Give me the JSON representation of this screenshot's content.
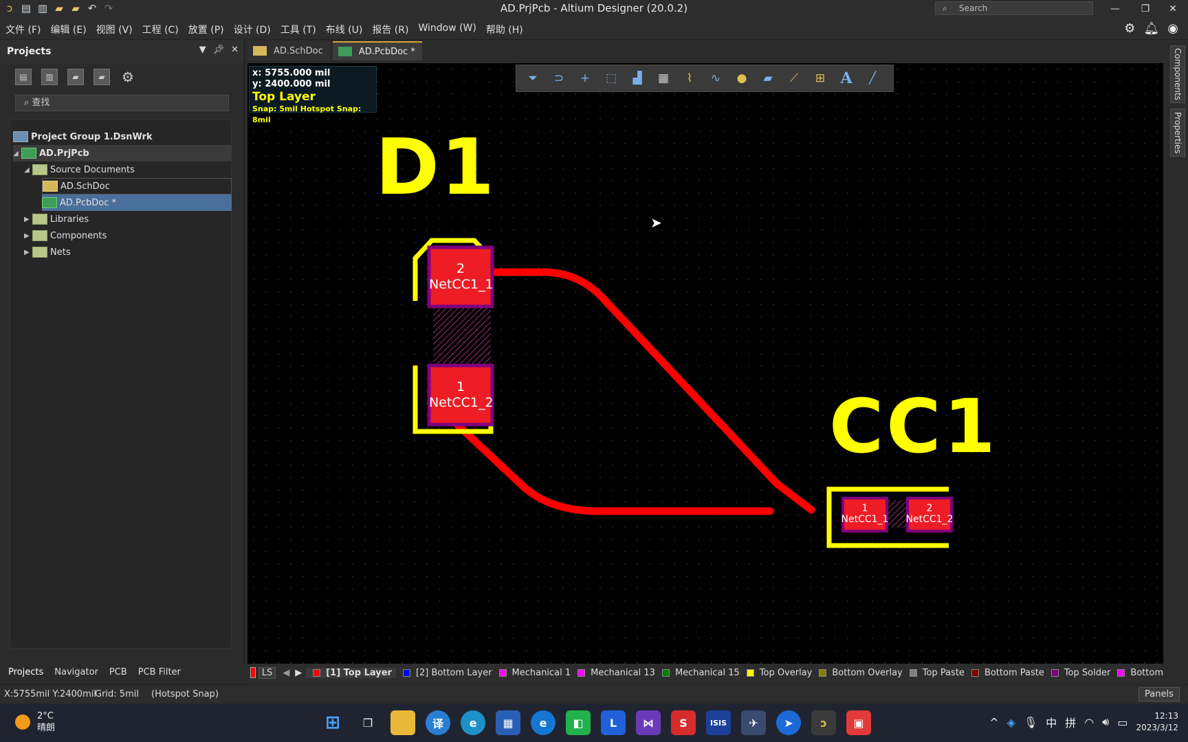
{
  "app": {
    "title": "AD.PrjPcb - Altium Designer (20.0.2)",
    "search_placeholder": "Search"
  },
  "menu": [
    "文件 (F)",
    "编辑 (E)",
    "视图 (V)",
    "工程 (C)",
    "放置 (P)",
    "设计 (D)",
    "工具 (T)",
    "布线 (U)",
    "报告 (R)",
    "Window (W)",
    "帮助 (H)"
  ],
  "projects_panel": {
    "title": "Projects",
    "search_placeholder": "查找",
    "tree": [
      {
        "label": "Project Group 1.DsnWrk",
        "level": 0
      },
      {
        "label": "AD.PrjPcb",
        "level": 1
      },
      {
        "label": "Source Documents",
        "level": 2
      },
      {
        "label": "AD.SchDoc",
        "level": 3
      },
      {
        "label": "AD.PcbDoc *",
        "level": 3
      },
      {
        "label": "Libraries",
        "level": 2
      },
      {
        "label": "Components",
        "level": 2
      },
      {
        "label": "Nets",
        "level": 2
      }
    ],
    "bottom_tabs": [
      "Projects",
      "Navigator",
      "PCB",
      "PCB Filter"
    ]
  },
  "doc_tabs": [
    {
      "label": "AD.SchDoc"
    },
    {
      "label": "AD.PcbDoc *"
    }
  ],
  "hud": {
    "x": "x:  5755.000 mil",
    "y": "y:  2400.000 mil",
    "layer": "Top Layer",
    "snap": "Snap: 5mil Hotspot Snap: 8mil"
  },
  "pcb": {
    "d1": {
      "designator": "D1",
      "pad2_num": "2",
      "pad2_net": "NetCC1_1",
      "pad1_num": "1",
      "pad1_net": "NetCC1_2"
    },
    "cc1": {
      "designator": "CC1",
      "pad1_num": "1",
      "pad1_net": "NetCC1_1",
      "pad2_num": "2",
      "pad2_net": "NetCC1_2"
    },
    "colors": {
      "track": "#ff0000",
      "overlay": "#ffff00",
      "pad": "#ee1c24",
      "solder": "#800080"
    }
  },
  "right_panels": [
    "Components",
    "Properties"
  ],
  "layers": [
    {
      "label": "LS",
      "color": ""
    },
    {
      "label": "[1] Top Layer",
      "color": "#ff0000"
    },
    {
      "label": "[2] Bottom Layer",
      "color": "#0000ff"
    },
    {
      "label": "Mechanical 1",
      "color": "#ff00ff"
    },
    {
      "label": "Mechanical 13",
      "color": "#ff00ff"
    },
    {
      "label": "Mechanical 15",
      "color": "#008000"
    },
    {
      "label": "Top Overlay",
      "color": "#ffff00"
    },
    {
      "label": "Bottom Overlay",
      "color": "#808000"
    },
    {
      "label": "Top Paste",
      "color": "#808080"
    },
    {
      "label": "Bottom Paste",
      "color": "#800000"
    },
    {
      "label": "Top Solder",
      "color": "#800080"
    },
    {
      "label": "Bottom",
      "color": "#ff00ff"
    }
  ],
  "status": {
    "coords": "X:5755mil Y:2400mil",
    "grid": "Grid: 5mil",
    "snap": "(Hotspot Snap)",
    "panels": "Panels"
  },
  "taskbar": {
    "temp": "2°C",
    "weather": "晴朗",
    "time": "12:13",
    "date": "2023/3/12",
    "ime1": "中",
    "ime2": "拼"
  }
}
